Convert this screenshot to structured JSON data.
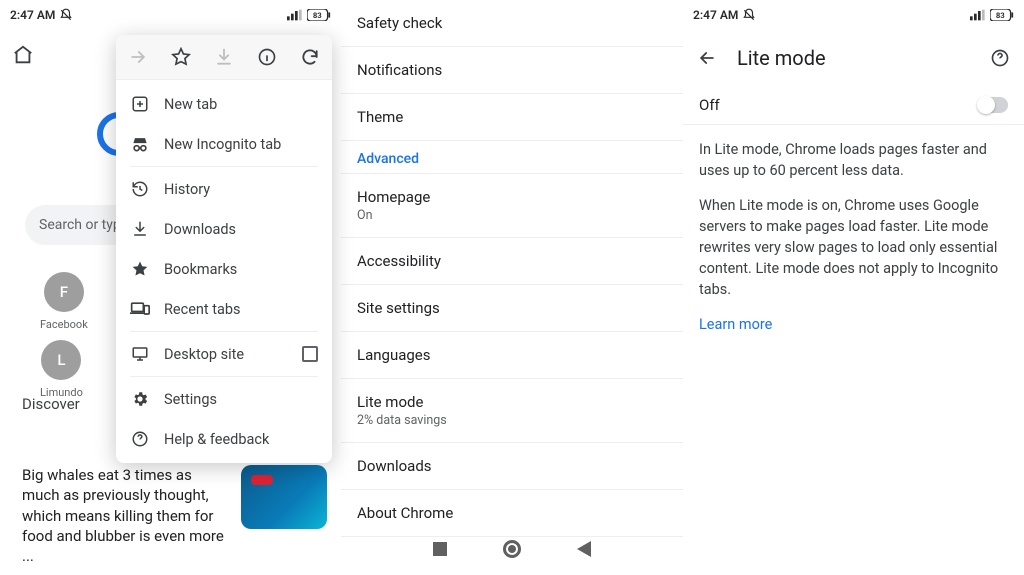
{
  "status": {
    "time": "2:47 AM",
    "battery": "83"
  },
  "panel1": {
    "search_placeholder": "Search or type",
    "shortcuts": [
      {
        "initial": "F",
        "label": "Facebook"
      },
      {
        "initial": "L",
        "label": "Limundo"
      }
    ],
    "discover": "Discover",
    "article": "Big whales eat 3 times as much as previously thought, which means killing them for food and blubber is even more ...",
    "menu": {
      "new_tab": "New tab",
      "incognito": "New Incognito tab",
      "history": "History",
      "downloads": "Downloads",
      "bookmarks": "Bookmarks",
      "recent": "Recent tabs",
      "desktop": "Desktop site",
      "settings": "Settings",
      "help": "Help & feedback"
    }
  },
  "panel2": {
    "safety": "Safety check",
    "notifications": "Notifications",
    "theme": "Theme",
    "advanced": "Advanced",
    "homepage": "Homepage",
    "homepage_sub": "On",
    "accessibility": "Accessibility",
    "site_settings": "Site settings",
    "languages": "Languages",
    "lite_mode": "Lite mode",
    "lite_mode_sub": "2% data savings",
    "downloads": "Downloads",
    "about": "About Chrome"
  },
  "panel3": {
    "title": "Lite mode",
    "toggle_label": "Off",
    "desc1": "In Lite mode, Chrome loads pages faster and uses up to 60 percent less data.",
    "desc2": "When Lite mode is on, Chrome uses Google servers to make pages load faster. Lite mode rewrites very slow pages to load only essential content. Lite mode does not apply to Incognito tabs.",
    "learn": "Learn more"
  }
}
